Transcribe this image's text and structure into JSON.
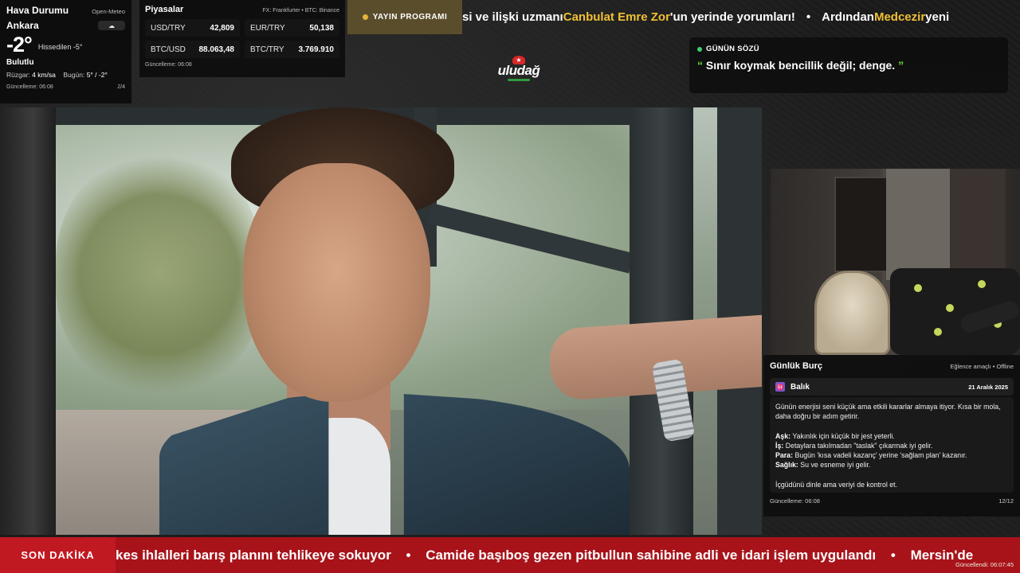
{
  "weather": {
    "title": "Hava Durumu",
    "source": "Open-Meteo",
    "city": "Ankara",
    "temp": "-2°",
    "feels_like": "Hissedilen -5°",
    "condition": "Bulutlu",
    "wind_label": "Rüzgar:",
    "wind_value": "4 km/sa",
    "today_label": "Bugün:",
    "today_value": "5° / -2°",
    "updated": "Güncelleme: 06:08",
    "page": "2/4",
    "condition_icon": "cloud-icon"
  },
  "markets": {
    "title": "Piyasalar",
    "source": "FX: Frankfurter • BTC: Binance",
    "items": [
      {
        "label": "USD/TRY",
        "value": "42,809"
      },
      {
        "label": "EUR/TRY",
        "value": "50,138"
      },
      {
        "label": "BTC/USD",
        "value": "88.063,48"
      },
      {
        "label": "BTC/TRY",
        "value": "3.769.910"
      }
    ],
    "updated": "Güncelleme: 06:08"
  },
  "top_ticker": {
    "program_label": "YAYIN PROGRAMI",
    "part1": "si ve ilişki uzmanı ",
    "highlight1": "Canbulat Emre Zor",
    "part2": "'un yerinde yorumları!",
    "separator": "•",
    "part3": "Ardından ",
    "highlight2": "Medcezir",
    "part4": " yeni"
  },
  "logo": {
    "text": "uludağ"
  },
  "quote": {
    "title": "GÜNÜN SÖZÜ",
    "open_mark": "“",
    "text": " Sınır koymak bencillik değil; denge. ",
    "close_mark": "”"
  },
  "horoscope": {
    "title": "Günlük Burç",
    "tag": "Eğlence amaçlı • Offline",
    "sign": "Balık",
    "sign_icon": "♓",
    "date": "21 Aralık 2025",
    "intro": "Günün enerjisi seni küçük ama etkili kararlar almaya itiyor. Kısa bir mola, daha doğru bir adım getirir.",
    "love_label": "Aşk:",
    "love": " Yakınlık için küçük bir jest yeterli.",
    "work_label": "İş:",
    "work": " Detaylara takılmadan \"taslak\" çıkarmak iyi gelir.",
    "money_label": "Para:",
    "money": " Bugün 'kısa vadeli kazanç' yerine 'sağlam plan' kazanır.",
    "health_label": "Sağlık:",
    "health": " Su ve esneme iyi gelir.",
    "closing": "İçgüdünü dinle ama veriyi de kontrol et.",
    "updated": "Güncelleme: 06:08",
    "page": "12/12"
  },
  "breaking": {
    "label": "SON DAKİKA",
    "item1": "kes ihlalleri barış planını tehlikeye sokuyor",
    "separator": "•",
    "item2": "Camide başıboş gezen pitbullun sahibine adli ve idari işlem uygulandı",
    "item3": "Mersin'de",
    "updated": "Güncellendi: 06:07:45"
  },
  "colors": {
    "accent_yellow": "#f0c035",
    "breaking_red": "#a8131a",
    "quote_green": "#6fdc3b",
    "sign_purple": "#7b55d6"
  }
}
